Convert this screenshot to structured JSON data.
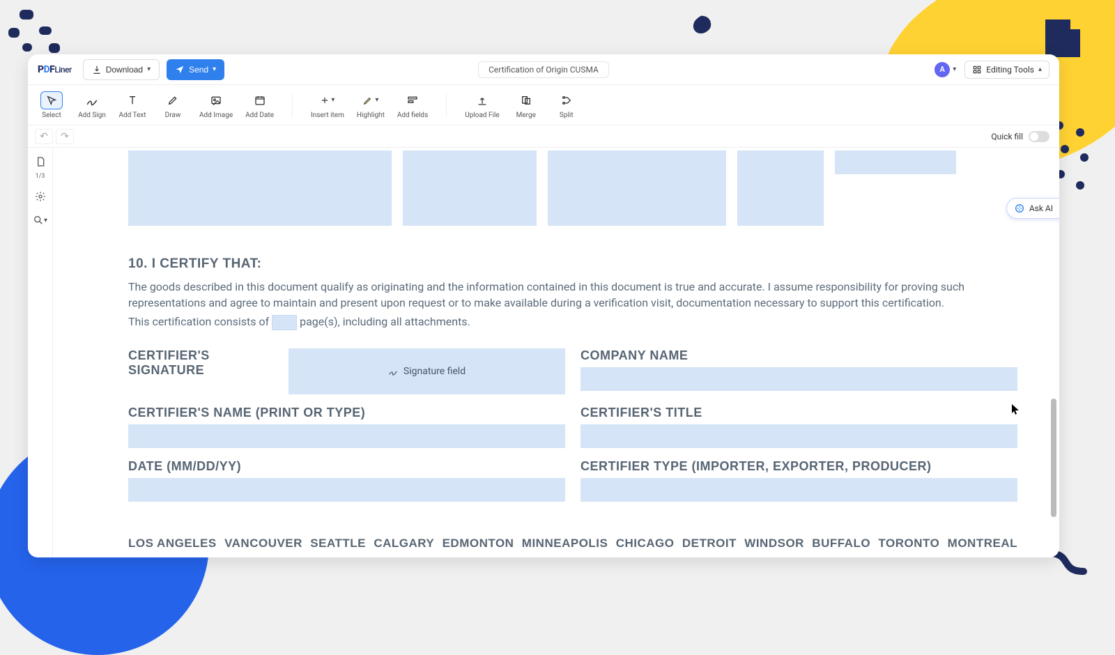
{
  "header": {
    "logo_a": "PDF",
    "logo_b": "Liner",
    "download": "Download",
    "send": "Send",
    "doc_title": "Certification of Origin CUSMA",
    "avatar": "A",
    "editing_tools": "Editing Tools"
  },
  "toolbar": {
    "select": "Select",
    "add_sign": "Add Sign",
    "add_text": "Add Text",
    "draw": "Draw",
    "add_image": "Add Image",
    "add_date": "Add Date",
    "insert_item": "Insert item",
    "highlight": "Highlight",
    "add_fields": "Add fields",
    "upload_file": "Upload File",
    "merge": "Merge",
    "split": "Split"
  },
  "substrip": {
    "quick_fill": "Quick fill"
  },
  "leftbar": {
    "page_count": "1/3"
  },
  "askai": "Ask AI",
  "doc": {
    "section_title": "10. I CERTIFY THAT:",
    "body_1": "The goods described in this document qualify as originating and the information contained in this document is true and accurate. I assume responsibility for proving such representations and agree to maintain and present upon request or to make available during a verification visit, documentation necessary to support this certification.",
    "body_2a": "This certification consists of",
    "body_2b": "page(s), including all attachments.",
    "labels": {
      "signature": "CERTIFIER'S SIGNATURE",
      "company": "COMPANY NAME",
      "name": "CERTIFIER'S NAME (PRINT OR TYPE)",
      "title": "CERTIFIER'S TITLE",
      "date": "DATE (MM/DD/YY)",
      "type": "CERTIFIER TYPE (IMPORTER, EXPORTER, PRODUCER)"
    },
    "signature_placeholder": "Signature field",
    "cities": [
      "LOS ANGELES",
      "VANCOUVER",
      "SEATTLE",
      "CALGARY",
      "EDMONTON",
      "MINNEAPOLIS",
      "CHICAGO",
      "DETROIT",
      "WINDSOR",
      "BUFFALO",
      "TORONTO",
      "MONTREAL"
    ]
  }
}
